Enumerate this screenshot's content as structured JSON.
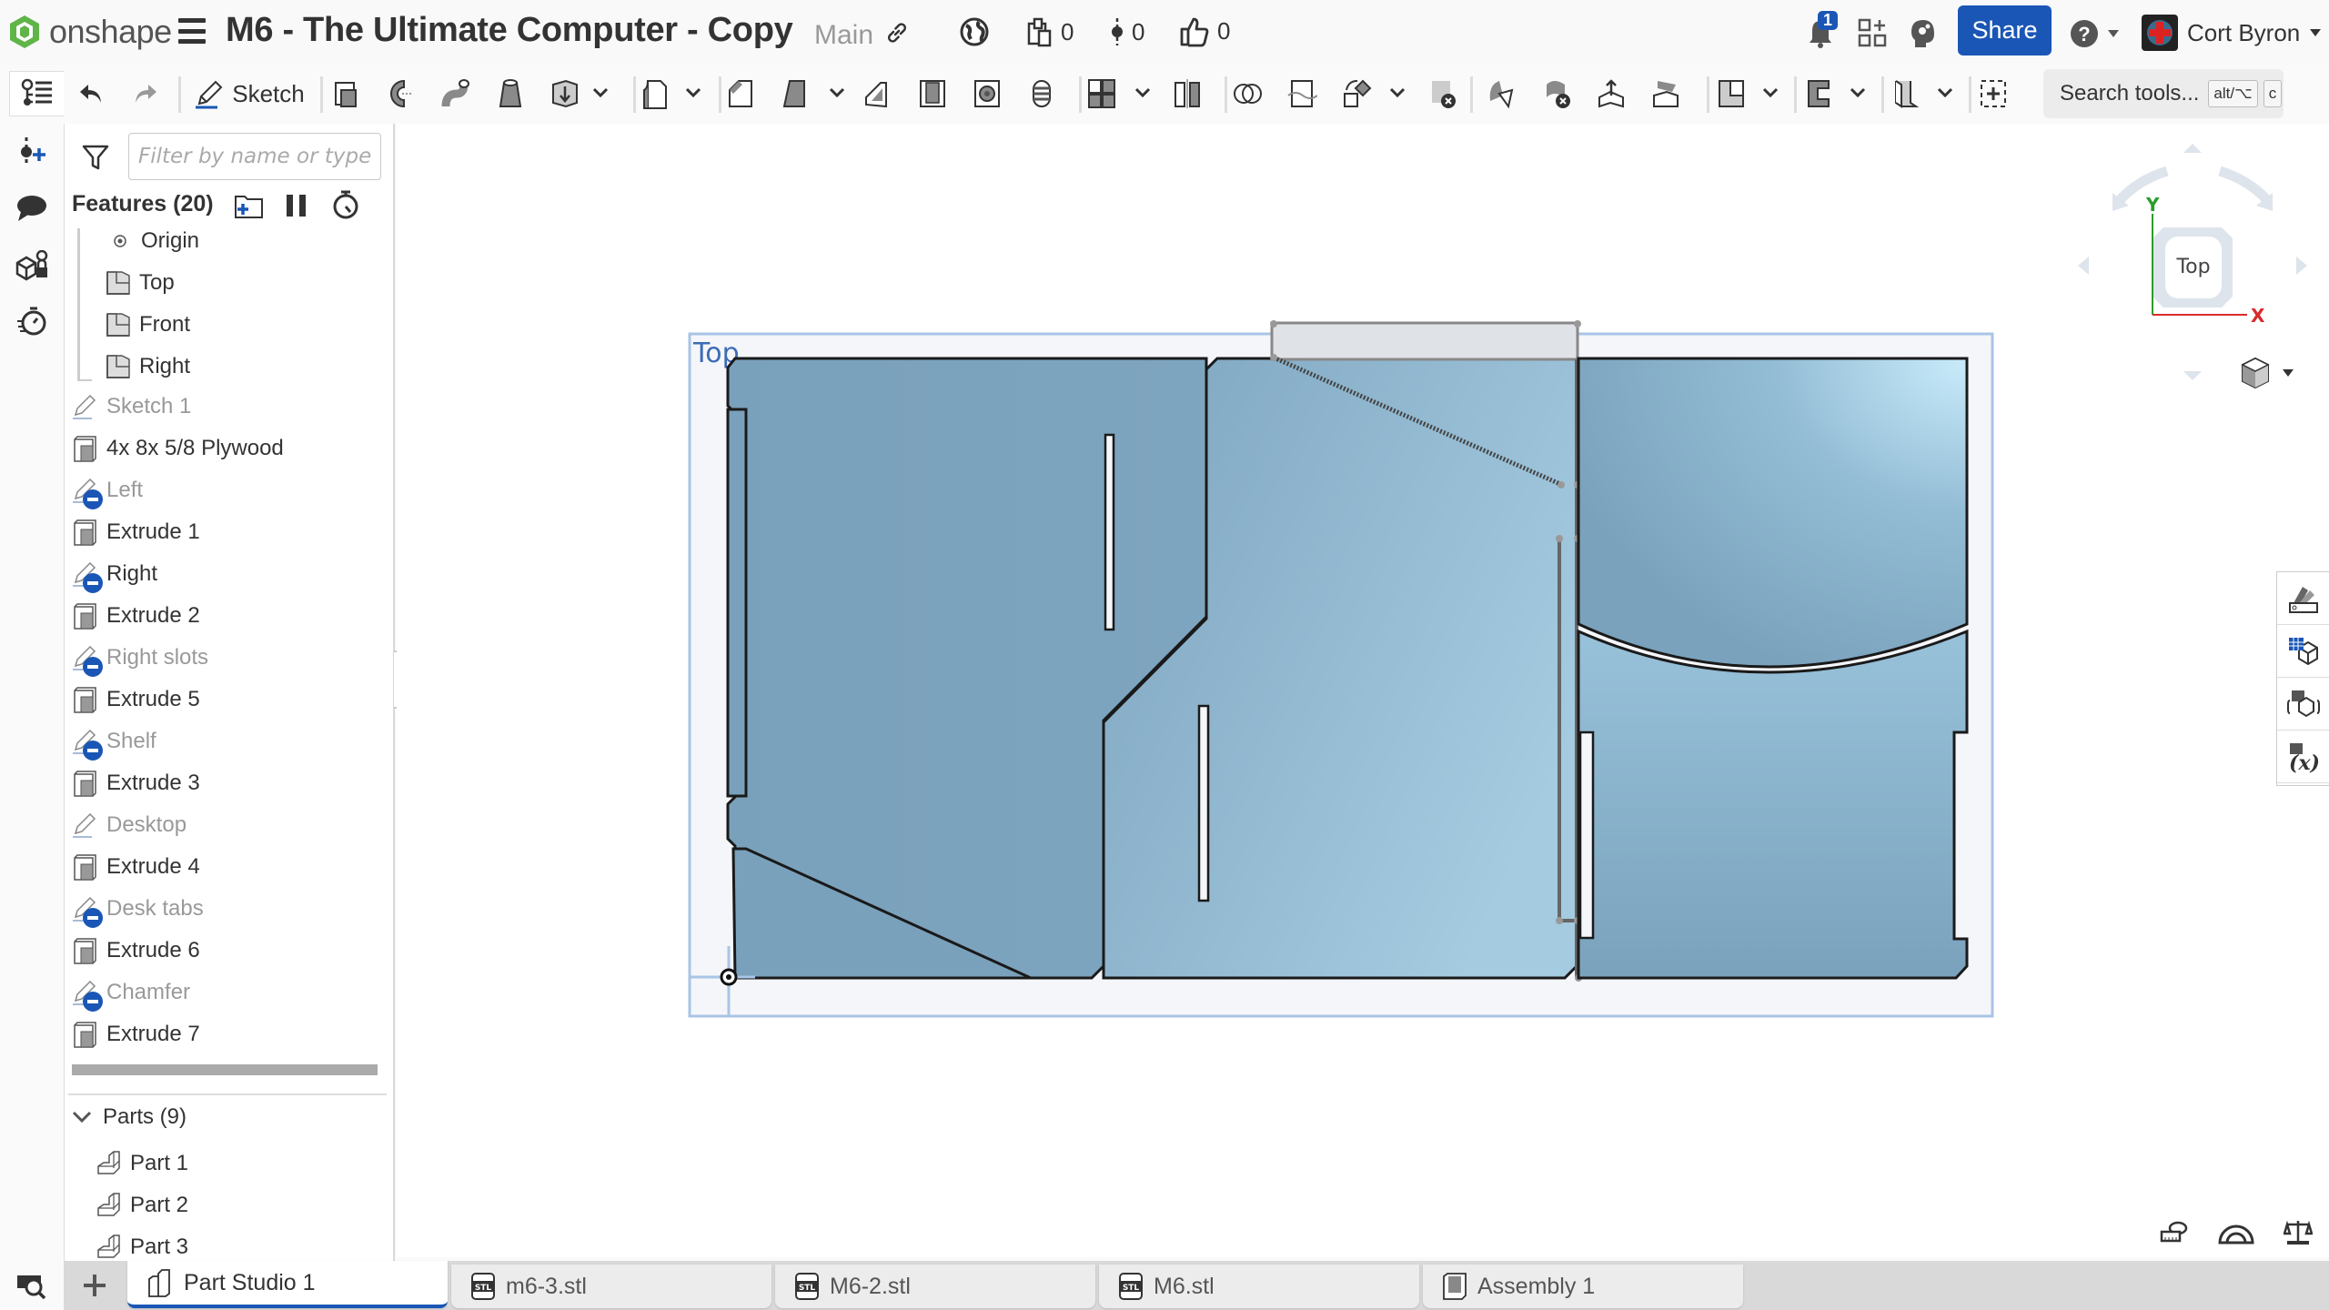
{
  "app": {
    "logo_text": "onshape",
    "document_title": "M6 - The Ultimate Computer - Copy",
    "branch": "Main",
    "counts": {
      "versions": "0",
      "branches": "0",
      "likes": "0"
    },
    "notifications_count": "1",
    "share_label": "Share",
    "user_name": "Cort Byron"
  },
  "toolbar": {
    "sketch_label": "Sketch",
    "search_label": "Search tools...",
    "search_shortcut_1": "alt/⌥",
    "search_shortcut_2": "c",
    "icons": [
      "undo-icon",
      "redo-icon",
      "sketch-icon",
      "extrude-icon",
      "revolve-icon",
      "sweep-icon",
      "loft-icon",
      "thicken-icon",
      "fillet-icon",
      "chamfer-icon",
      "draft-icon",
      "rib-icon",
      "shell-icon",
      "hole-icon",
      "thread-icon",
      "pattern-icon",
      "mirror-icon",
      "boolean-icon",
      "split-icon",
      "transform-icon",
      "delete-part-icon",
      "modify-fillet-icon",
      "delete-face-icon",
      "move-face-icon",
      "replace-face-icon",
      "plane-icon",
      "frame-icon",
      "sheet-metal-icon",
      "add-custom-feature-icon"
    ]
  },
  "feature_panel": {
    "filter_placeholder": "Filter by name or type",
    "features_title": "Features (20)",
    "default_items": [
      {
        "label": "Origin",
        "type": "origin"
      },
      {
        "label": "Top",
        "type": "plane"
      },
      {
        "label": "Front",
        "type": "plane"
      },
      {
        "label": "Right",
        "type": "plane"
      }
    ],
    "features": [
      {
        "label": "Sketch 1",
        "type": "sketch",
        "hidden": false,
        "dim": true
      },
      {
        "label": "4x 8x 5/8 Plywood",
        "type": "extrude",
        "hidden": false,
        "dim": false
      },
      {
        "label": "Left",
        "type": "sketch",
        "hidden": true,
        "dim": true
      },
      {
        "label": "Extrude 1",
        "type": "extrude",
        "hidden": false,
        "dim": false
      },
      {
        "label": "Right",
        "type": "sketch",
        "hidden": true,
        "dim": false
      },
      {
        "label": "Extrude 2",
        "type": "extrude",
        "hidden": false,
        "dim": false
      },
      {
        "label": "Right slots",
        "type": "sketch",
        "hidden": true,
        "dim": true
      },
      {
        "label": "Extrude 5",
        "type": "extrude",
        "hidden": false,
        "dim": false
      },
      {
        "label": "Shelf",
        "type": "sketch",
        "hidden": true,
        "dim": true
      },
      {
        "label": "Extrude 3",
        "type": "extrude",
        "hidden": false,
        "dim": false
      },
      {
        "label": "Desktop",
        "type": "sketch",
        "hidden": false,
        "dim": true
      },
      {
        "label": "Extrude 4",
        "type": "extrude",
        "hidden": false,
        "dim": false
      },
      {
        "label": "Desk tabs",
        "type": "sketch",
        "hidden": true,
        "dim": true
      },
      {
        "label": "Extrude 6",
        "type": "extrude",
        "hidden": false,
        "dim": false
      },
      {
        "label": "Chamfer",
        "type": "sketch",
        "hidden": true,
        "dim": true
      },
      {
        "label": "Extrude 7",
        "type": "extrude",
        "hidden": false,
        "dim": false
      }
    ],
    "parts_title": "Parts (9)",
    "parts": [
      "Part 1",
      "Part 2",
      "Part 3"
    ]
  },
  "viewport": {
    "plane_label": "Top",
    "view_cube_face": "Top",
    "axis_x": "X",
    "axis_y": "Y",
    "colors": {
      "part_fill": "#7ea3bc",
      "part_highlight": "#c9ecfb",
      "plane_border": "#a9c4e6",
      "plane_label": "#3d6cb5",
      "axis_x": "#d92b2b",
      "axis_y": "#2a9d2a"
    }
  },
  "tabs": [
    {
      "label": "Part Studio 1",
      "type": "partstudio",
      "active": true
    },
    {
      "label": "m6-3.stl",
      "type": "stl",
      "active": false
    },
    {
      "label": "M6-2.stl",
      "type": "stl",
      "active": false
    },
    {
      "label": "M6.stl",
      "type": "stl",
      "active": false
    },
    {
      "label": "Assembly 1",
      "type": "assembly",
      "active": false
    }
  ],
  "colors": {
    "accent": "#1a56b5",
    "brand_green": "#5fb547"
  }
}
